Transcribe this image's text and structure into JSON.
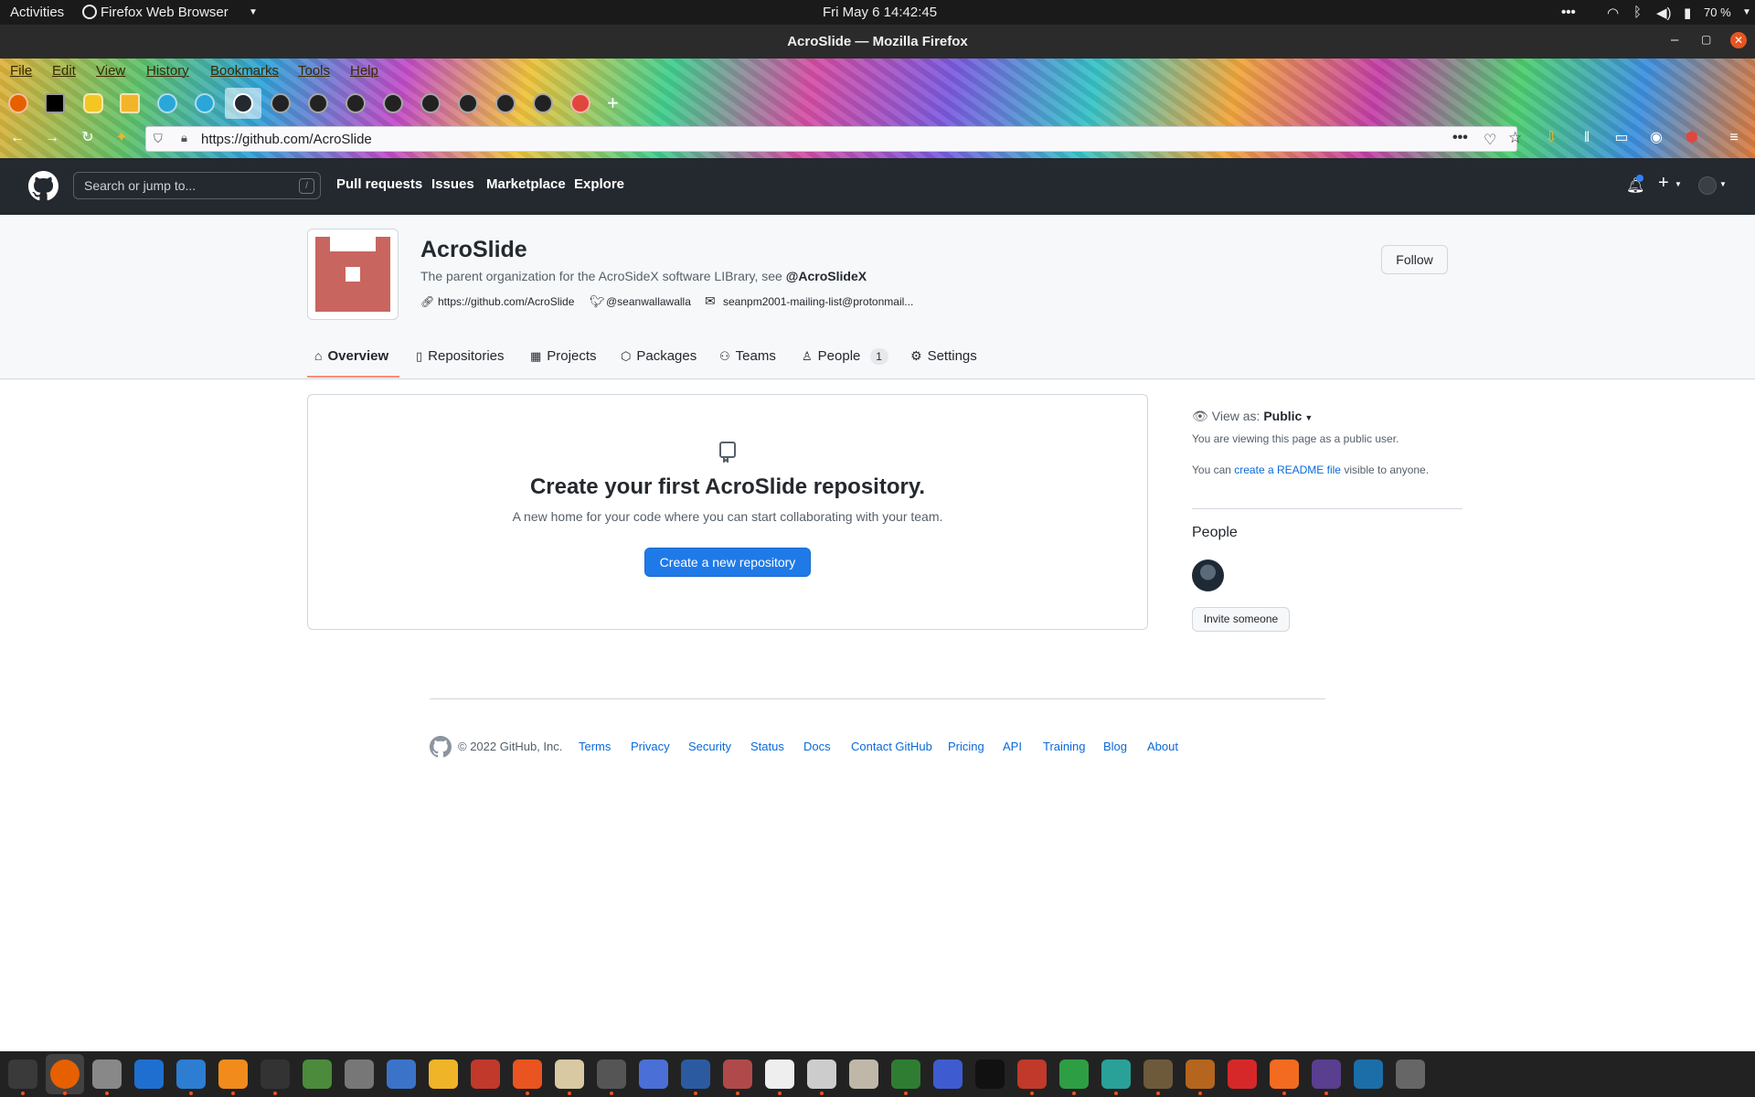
{
  "topbar": {
    "activities": "Activities",
    "app_menu": "Firefox Web Browser",
    "clock": "Fri May 6  14:42:45",
    "battery": "70 %"
  },
  "window": {
    "title": "AcroSlide — Mozilla Firefox"
  },
  "menubar": [
    "File",
    "Edit",
    "View",
    "History",
    "Bookmarks",
    "Tools",
    "Help"
  ],
  "urlbar": {
    "url_prefix": "https://github.com/",
    "url_path": "AcroSlide"
  },
  "github": {
    "search_placeholder": "Search or jump to...",
    "search_key": "/",
    "nav": [
      "Pull requests",
      "Issues",
      "Marketplace",
      "Explore"
    ]
  },
  "org": {
    "name": "AcroSlide",
    "description": "The parent organization for the AcroSideX software LIBrary, see ",
    "description_mention": "@AcroSlideX",
    "website": "https://github.com/AcroSlide",
    "twitter": "@seanwallawalla",
    "email": "seanpm2001-mailing-list@protonmail...",
    "follow_label": "Follow",
    "avatar_color": "#c9655f"
  },
  "tabs": [
    {
      "label": "Overview",
      "icon": "home-icon",
      "selected": true
    },
    {
      "label": "Repositories",
      "icon": "repo-icon"
    },
    {
      "label": "Projects",
      "icon": "project-icon"
    },
    {
      "label": "Packages",
      "icon": "package-icon"
    },
    {
      "label": "Teams",
      "icon": "people-icon"
    },
    {
      "label": "People",
      "icon": "person-icon",
      "count": "1"
    },
    {
      "label": "Settings",
      "icon": "gear-icon"
    }
  ],
  "blankslate": {
    "title": "Create your first AcroSlide repository.",
    "subtitle": "A new home for your code where you can start collaborating with your team.",
    "button": "Create a new repository"
  },
  "sidebar": {
    "view_as_label": "View as: ",
    "view_as_value": "Public",
    "viewing_note": "You are viewing this page as a public user.",
    "readme_prefix": "You can ",
    "readme_link": "create a README file",
    "readme_suffix": " visible to anyone.",
    "people_heading": "People",
    "invite_label": "Invite someone"
  },
  "footer": {
    "copyright": "© 2022 GitHub, Inc.",
    "links": [
      "Terms",
      "Privacy",
      "Security",
      "Status",
      "Docs",
      "Contact GitHub",
      "Pricing",
      "API",
      "Training",
      "Blog",
      "About"
    ]
  },
  "colors": {
    "accent_blue": "#0969da",
    "button_blue": "#1f7ae8",
    "tab_underline": "#fd8c73",
    "gh_header": "#24292f"
  },
  "dock_apps": [
    "system-monitor",
    "firefox",
    "settings",
    "help",
    "writer",
    "vlc",
    "terminal",
    "add-app",
    "image-viewer",
    "text-editor",
    "calculator",
    "system-profiler",
    "software-store",
    "files",
    "disk-utility",
    "reminders",
    "writing-tool",
    "document-viewer",
    "archive",
    "character-map",
    "file-roller",
    "vim",
    "screenshot",
    "music",
    "pdf-viewer",
    "calc",
    "calendar",
    "gimp",
    "game",
    "alert",
    "update",
    "screen-recorder",
    "weather",
    "software-updater",
    "app-grid"
  ]
}
